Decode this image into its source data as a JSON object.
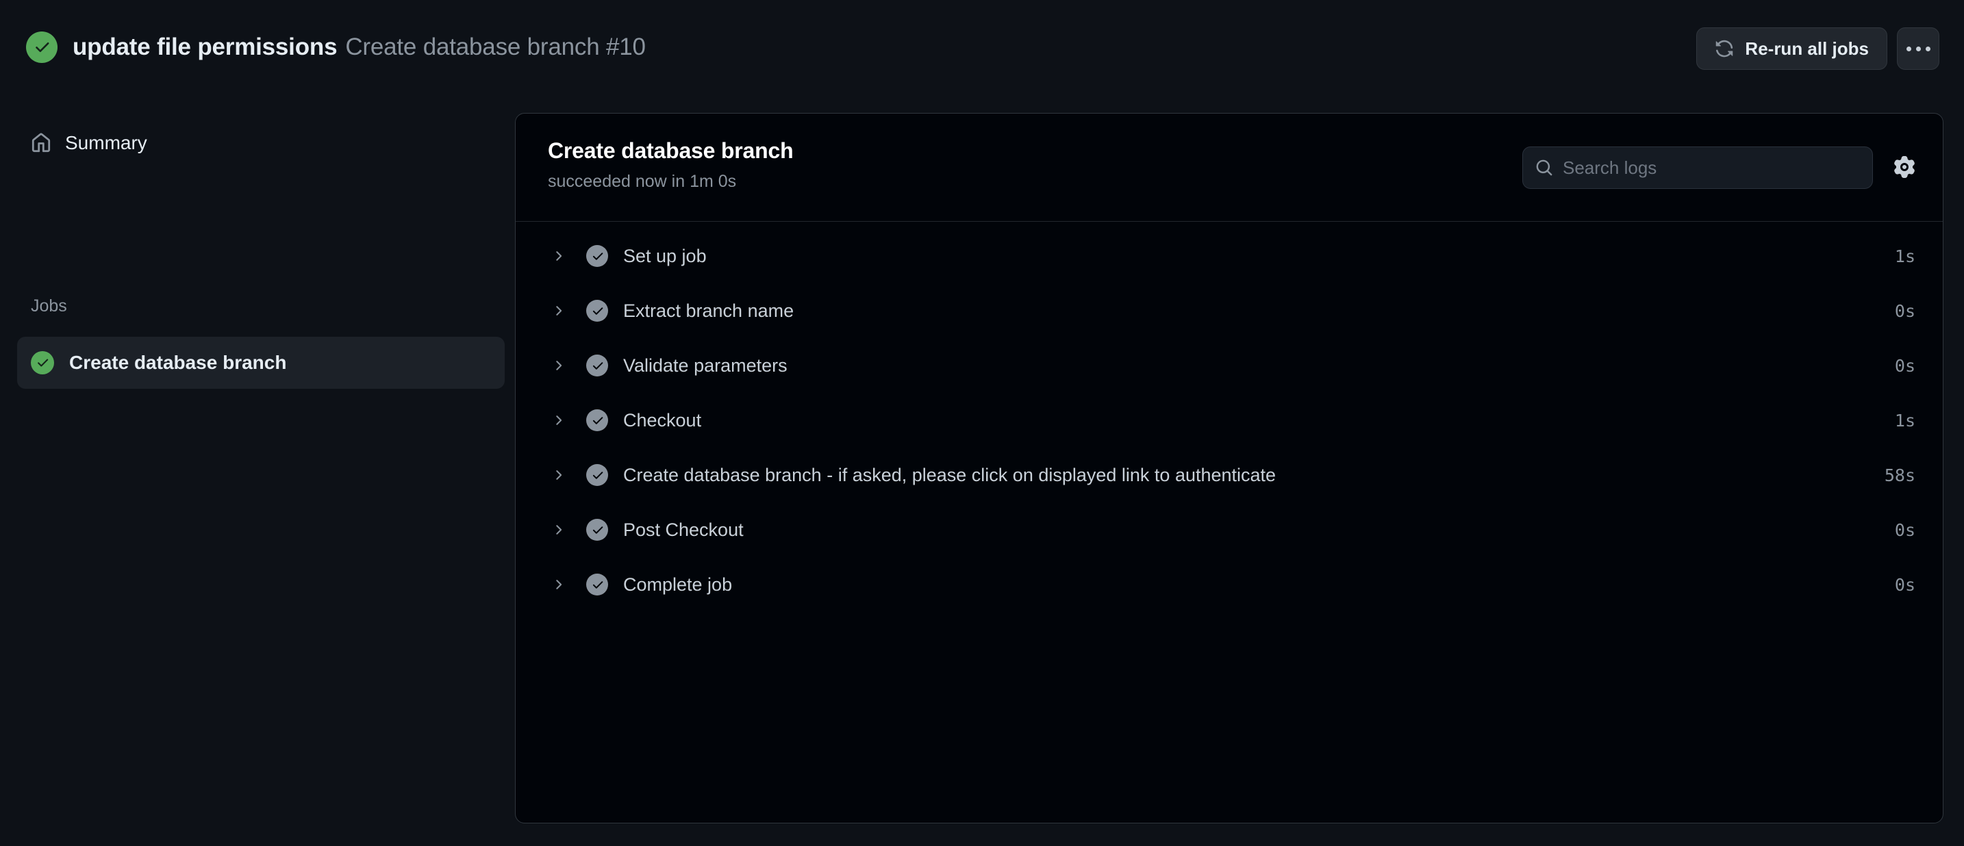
{
  "header": {
    "status_icon": "check-circle-green-icon",
    "run_title": "update file permissions",
    "run_subtitle": "Create database branch #10",
    "rerun_button": "Re-run all jobs",
    "rerun_icon": "sync-icon",
    "kebab_icon": "kebab-horizontal-icon"
  },
  "sidebar": {
    "summary": {
      "label": "Summary",
      "icon": "home-icon"
    },
    "section_title": "Jobs",
    "jobs": [
      {
        "label": "Create database branch",
        "status": "succeeded",
        "icon": "check-circle-green-icon",
        "selected": true
      }
    ]
  },
  "log_panel": {
    "title": "Create database branch",
    "subtitle": "succeeded now in 1m 0s",
    "search": {
      "placeholder": "Search logs",
      "value": "",
      "icon": "search-icon"
    },
    "settings_icon": "gear-icon",
    "steps": [
      {
        "name": "Set up job",
        "duration": "1s",
        "status": "succeeded",
        "expand_icon": "chevron-right-icon",
        "status_icon": "check-circle-gray-icon"
      },
      {
        "name": "Extract branch name",
        "duration": "0s",
        "status": "succeeded",
        "expand_icon": "chevron-right-icon",
        "status_icon": "check-circle-gray-icon"
      },
      {
        "name": "Validate parameters",
        "duration": "0s",
        "status": "succeeded",
        "expand_icon": "chevron-right-icon",
        "status_icon": "check-circle-gray-icon"
      },
      {
        "name": "Checkout",
        "duration": "1s",
        "status": "succeeded",
        "expand_icon": "chevron-right-icon",
        "status_icon": "check-circle-gray-icon"
      },
      {
        "name": "Create database branch - if asked, please click on displayed link to authenticate",
        "duration": "58s",
        "status": "succeeded",
        "expand_icon": "chevron-right-icon",
        "status_icon": "check-circle-gray-icon"
      },
      {
        "name": "Post Checkout",
        "duration": "0s",
        "status": "succeeded",
        "expand_icon": "chevron-right-icon",
        "status_icon": "check-circle-gray-icon"
      },
      {
        "name": "Complete job",
        "duration": "0s",
        "status": "succeeded",
        "expand_icon": "chevron-right-icon",
        "status_icon": "check-circle-gray-icon"
      }
    ]
  },
  "colors": {
    "page_bg": "#0d1117",
    "panel_bg": "#010409",
    "border": "#30363d",
    "success_green": "#57ab5a",
    "text_primary": "#e6edf3",
    "text_muted": "#8b949e",
    "selected_bg": "#1c2128"
  }
}
